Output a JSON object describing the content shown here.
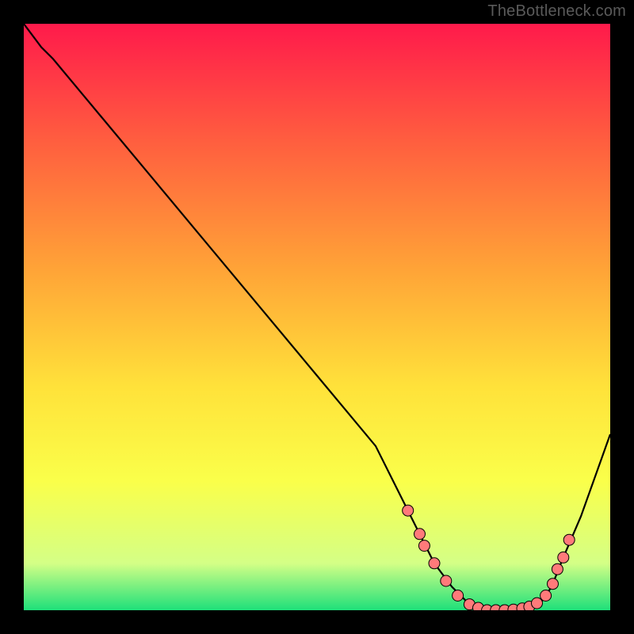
{
  "watermark": "TheBottleneck.com",
  "colors": {
    "gradient_top": "#ff1a4b",
    "gradient_1": "#ff5e3f",
    "gradient_2": "#ffa437",
    "gradient_3": "#ffe23a",
    "gradient_4": "#faff4a",
    "gradient_5": "#d4ff86",
    "gradient_bottom": "#1ee07a",
    "curve": "#000000",
    "marker_fill": "#ff7a7a",
    "marker_stroke": "#000000",
    "background": "#000000"
  },
  "chart_data": {
    "type": "line",
    "title": "",
    "xlabel": "",
    "ylabel": "",
    "xlim": [
      0,
      100
    ],
    "ylim": [
      0,
      100
    ],
    "grid": false,
    "legend": false,
    "series": [
      {
        "name": "bottleneck-curve",
        "x": [
          0,
          3,
          5,
          10,
          20,
          30,
          40,
          50,
          60,
          64,
          66,
          68,
          70,
          73,
          76,
          79,
          82,
          85,
          88,
          90,
          92,
          95,
          100
        ],
        "y": [
          100,
          96,
          94,
          88,
          76,
          64,
          52,
          40,
          28,
          20,
          16,
          12,
          8,
          4,
          1,
          0,
          0,
          0,
          1,
          4,
          9,
          16,
          30
        ]
      }
    ],
    "markers": {
      "name": "optimal-range-points",
      "points": [
        {
          "x": 65.5,
          "y": 17
        },
        {
          "x": 67.5,
          "y": 13
        },
        {
          "x": 68.3,
          "y": 11
        },
        {
          "x": 70.0,
          "y": 8
        },
        {
          "x": 72.0,
          "y": 5
        },
        {
          "x": 74.0,
          "y": 2.5
        },
        {
          "x": 76.0,
          "y": 1
        },
        {
          "x": 77.5,
          "y": 0.4
        },
        {
          "x": 79.0,
          "y": 0
        },
        {
          "x": 80.5,
          "y": 0
        },
        {
          "x": 82.0,
          "y": 0
        },
        {
          "x": 83.5,
          "y": 0.1
        },
        {
          "x": 85.0,
          "y": 0.3
        },
        {
          "x": 86.2,
          "y": 0.6
        },
        {
          "x": 87.5,
          "y": 1.2
        },
        {
          "x": 89.0,
          "y": 2.5
        },
        {
          "x": 90.2,
          "y": 4.5
        },
        {
          "x": 91.0,
          "y": 7
        },
        {
          "x": 92.0,
          "y": 9
        },
        {
          "x": 93.0,
          "y": 12
        }
      ]
    }
  }
}
